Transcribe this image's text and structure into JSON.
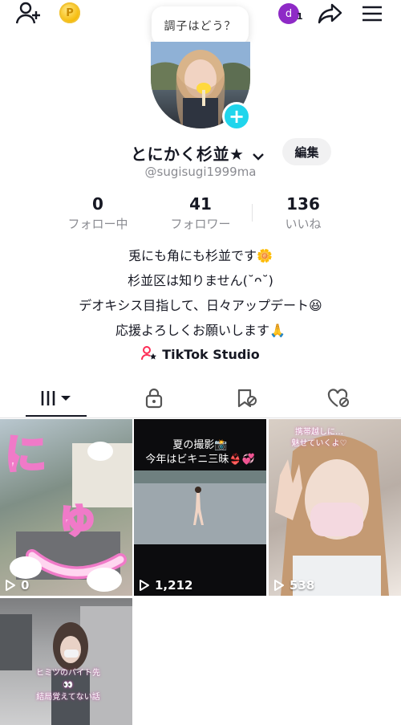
{
  "topbar": {
    "add_friend_icon": "person-plus-icon",
    "coin_symbol": "P",
    "notification_initial": "d",
    "notification_count": "1",
    "share_icon": "share-arrow-icon",
    "menu_icon": "hamburger-icon"
  },
  "prompt_bubble": "調子はどう？",
  "profile": {
    "display_name": "とにかく杉並★",
    "edit_label": "編集",
    "username": "@sugisugi1999ma"
  },
  "stats": [
    {
      "value": "0",
      "label": "フォロー中"
    },
    {
      "value": "41",
      "label": "フォロワー"
    },
    {
      "value": "136",
      "label": "いいね"
    }
  ],
  "bio": [
    "兎にも角にも杉並です🌼",
    "杉並区は知りません(˘ᴖ˘)",
    "デオキシス目指して、日々アップデート😆",
    "応援よろしくお願いします🙏"
  ],
  "studio_link": "TikTok Studio",
  "tabs": [
    {
      "name": "videos",
      "icon": "grid-icon"
    },
    {
      "name": "private",
      "icon": "lock-icon"
    },
    {
      "name": "saved",
      "icon": "bookmark-icon"
    },
    {
      "name": "liked",
      "icon": "heart-icon"
    }
  ],
  "videos": [
    {
      "views": "0",
      "overlay": "にゅ〜"
    },
    {
      "views": "1,212",
      "overlay": "夏の撮影📸\n今年はビキニ三昧👙💞"
    },
    {
      "views": "538",
      "overlay": "携帯越しに…\n魅せていくよ♡"
    },
    {
      "views": "",
      "overlay": "ヒミツのバイト先\n👀\n結局覚えてない話"
    }
  ],
  "colors": {
    "accent": "#20d5ec",
    "text": "#161823",
    "muted": "#8a8b91",
    "badge": "#8e2ac6"
  }
}
